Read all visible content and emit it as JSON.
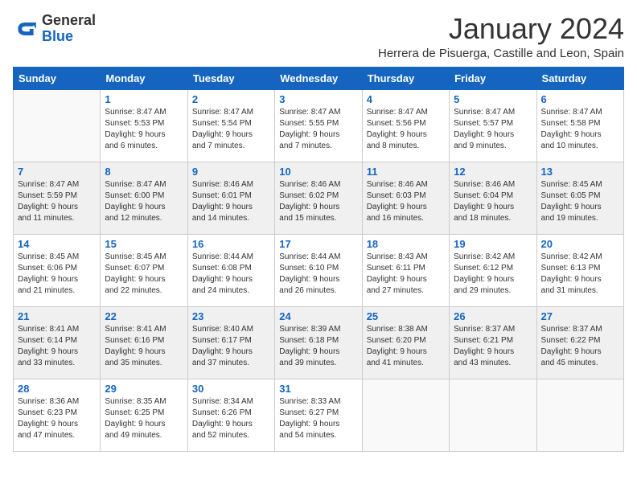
{
  "header": {
    "logo_general": "General",
    "logo_blue": "Blue",
    "month_year": "January 2024",
    "location": "Herrera de Pisuerga, Castille and Leon, Spain"
  },
  "weekdays": [
    "Sunday",
    "Monday",
    "Tuesday",
    "Wednesday",
    "Thursday",
    "Friday",
    "Saturday"
  ],
  "weeks": [
    [
      {
        "day": "",
        "info": ""
      },
      {
        "day": "1",
        "info": "Sunrise: 8:47 AM\nSunset: 5:53 PM\nDaylight: 9 hours\nand 6 minutes."
      },
      {
        "day": "2",
        "info": "Sunrise: 8:47 AM\nSunset: 5:54 PM\nDaylight: 9 hours\nand 7 minutes."
      },
      {
        "day": "3",
        "info": "Sunrise: 8:47 AM\nSunset: 5:55 PM\nDaylight: 9 hours\nand 7 minutes."
      },
      {
        "day": "4",
        "info": "Sunrise: 8:47 AM\nSunset: 5:56 PM\nDaylight: 9 hours\nand 8 minutes."
      },
      {
        "day": "5",
        "info": "Sunrise: 8:47 AM\nSunset: 5:57 PM\nDaylight: 9 hours\nand 9 minutes."
      },
      {
        "day": "6",
        "info": "Sunrise: 8:47 AM\nSunset: 5:58 PM\nDaylight: 9 hours\nand 10 minutes."
      }
    ],
    [
      {
        "day": "7",
        "info": "Sunrise: 8:47 AM\nSunset: 5:59 PM\nDaylight: 9 hours\nand 11 minutes."
      },
      {
        "day": "8",
        "info": "Sunrise: 8:47 AM\nSunset: 6:00 PM\nDaylight: 9 hours\nand 12 minutes."
      },
      {
        "day": "9",
        "info": "Sunrise: 8:46 AM\nSunset: 6:01 PM\nDaylight: 9 hours\nand 14 minutes."
      },
      {
        "day": "10",
        "info": "Sunrise: 8:46 AM\nSunset: 6:02 PM\nDaylight: 9 hours\nand 15 minutes."
      },
      {
        "day": "11",
        "info": "Sunrise: 8:46 AM\nSunset: 6:03 PM\nDaylight: 9 hours\nand 16 minutes."
      },
      {
        "day": "12",
        "info": "Sunrise: 8:46 AM\nSunset: 6:04 PM\nDaylight: 9 hours\nand 18 minutes."
      },
      {
        "day": "13",
        "info": "Sunrise: 8:45 AM\nSunset: 6:05 PM\nDaylight: 9 hours\nand 19 minutes."
      }
    ],
    [
      {
        "day": "14",
        "info": "Sunrise: 8:45 AM\nSunset: 6:06 PM\nDaylight: 9 hours\nand 21 minutes."
      },
      {
        "day": "15",
        "info": "Sunrise: 8:45 AM\nSunset: 6:07 PM\nDaylight: 9 hours\nand 22 minutes."
      },
      {
        "day": "16",
        "info": "Sunrise: 8:44 AM\nSunset: 6:08 PM\nDaylight: 9 hours\nand 24 minutes."
      },
      {
        "day": "17",
        "info": "Sunrise: 8:44 AM\nSunset: 6:10 PM\nDaylight: 9 hours\nand 26 minutes."
      },
      {
        "day": "18",
        "info": "Sunrise: 8:43 AM\nSunset: 6:11 PM\nDaylight: 9 hours\nand 27 minutes."
      },
      {
        "day": "19",
        "info": "Sunrise: 8:42 AM\nSunset: 6:12 PM\nDaylight: 9 hours\nand 29 minutes."
      },
      {
        "day": "20",
        "info": "Sunrise: 8:42 AM\nSunset: 6:13 PM\nDaylight: 9 hours\nand 31 minutes."
      }
    ],
    [
      {
        "day": "21",
        "info": "Sunrise: 8:41 AM\nSunset: 6:14 PM\nDaylight: 9 hours\nand 33 minutes."
      },
      {
        "day": "22",
        "info": "Sunrise: 8:41 AM\nSunset: 6:16 PM\nDaylight: 9 hours\nand 35 minutes."
      },
      {
        "day": "23",
        "info": "Sunrise: 8:40 AM\nSunset: 6:17 PM\nDaylight: 9 hours\nand 37 minutes."
      },
      {
        "day": "24",
        "info": "Sunrise: 8:39 AM\nSunset: 6:18 PM\nDaylight: 9 hours\nand 39 minutes."
      },
      {
        "day": "25",
        "info": "Sunrise: 8:38 AM\nSunset: 6:20 PM\nDaylight: 9 hours\nand 41 minutes."
      },
      {
        "day": "26",
        "info": "Sunrise: 8:37 AM\nSunset: 6:21 PM\nDaylight: 9 hours\nand 43 minutes."
      },
      {
        "day": "27",
        "info": "Sunrise: 8:37 AM\nSunset: 6:22 PM\nDaylight: 9 hours\nand 45 minutes."
      }
    ],
    [
      {
        "day": "28",
        "info": "Sunrise: 8:36 AM\nSunset: 6:23 PM\nDaylight: 9 hours\nand 47 minutes."
      },
      {
        "day": "29",
        "info": "Sunrise: 8:35 AM\nSunset: 6:25 PM\nDaylight: 9 hours\nand 49 minutes."
      },
      {
        "day": "30",
        "info": "Sunrise: 8:34 AM\nSunset: 6:26 PM\nDaylight: 9 hours\nand 52 minutes."
      },
      {
        "day": "31",
        "info": "Sunrise: 8:33 AM\nSunset: 6:27 PM\nDaylight: 9 hours\nand 54 minutes."
      },
      {
        "day": "",
        "info": ""
      },
      {
        "day": "",
        "info": ""
      },
      {
        "day": "",
        "info": ""
      }
    ]
  ]
}
